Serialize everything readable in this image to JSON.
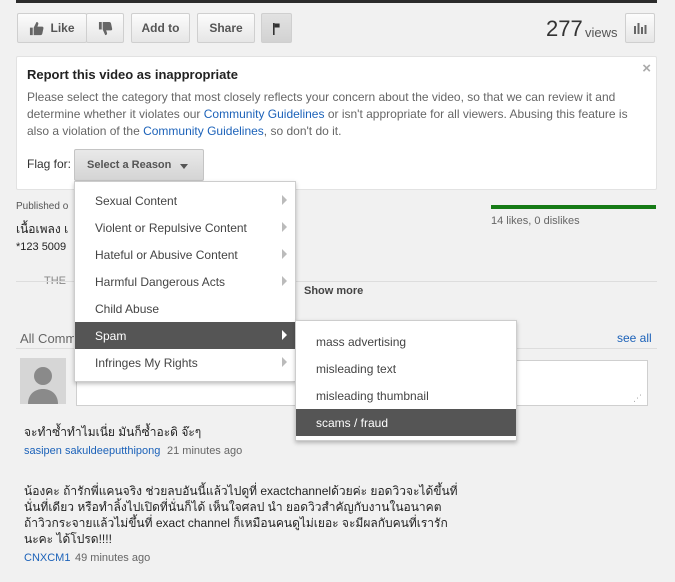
{
  "toolbar": {
    "like_label": "Like",
    "dislike_icon": "thumbs-down-icon",
    "addto_label": "Add to",
    "share_label": "Share",
    "flag_icon": "flag-icon",
    "views_count": "277",
    "views_label": "views",
    "stats_icon": "bar-chart-icon"
  },
  "report": {
    "title": "Report this video as inappropriate",
    "close_glyph": "×",
    "desc_part1": "Please select the category that most closely reflects your concern about the video, so that we can review it and determine whether it violates our ",
    "guidelines_link_1": "Community Guidelines",
    "desc_part2": " or isn't appropriate for all viewers. Abusing this feature is also a violation of the ",
    "guidelines_link_2": "Community Guidelines",
    "desc_part3": ", so don't do it.",
    "flag_for_label": "Flag for:",
    "select_label": "Select a Reason"
  },
  "reasons": [
    {
      "label": "Sexual Content",
      "has_submenu": true
    },
    {
      "label": "Violent or Repulsive Content",
      "has_submenu": true
    },
    {
      "label": "Hateful or Abusive Content",
      "has_submenu": true
    },
    {
      "label": "Harmful Dangerous Acts",
      "has_submenu": true
    },
    {
      "label": "Child Abuse",
      "has_submenu": false
    },
    {
      "label": "Spam",
      "has_submenu": true,
      "highlighted": true
    },
    {
      "label": "Infringes My Rights",
      "has_submenu": true
    }
  ],
  "spam_submenu": [
    {
      "label": "mass advertising"
    },
    {
      "label": "misleading text"
    },
    {
      "label": "misleading thumbnail"
    },
    {
      "label": "scams / fraud",
      "highlighted": true
    }
  ],
  "video_info": {
    "published": "Published o",
    "desc_line1": "เนื้อเพลง เ",
    "desc_line2": "*123 5009",
    "desc_line3": "THE",
    "likes_text": "14 likes, 0 dislikes",
    "show_more": "Show more"
  },
  "comments": {
    "header": "All Comm",
    "see_all": "see all",
    "list": [
      {
        "text": "จะทำซ้ำทำไมเนี่ย มันก็ซ้ำอะดิ จ๊ะๆ",
        "author": "sasipen sakuldeeputthipong",
        "time": "21 minutes ago"
      },
      {
        "text_lines": [
          "น้องคะ ถ้ารักพี่แคนจริง ช่วยลบอันนี้แล้วไปดูที่ exactchannelด้วยค่ะ ยอดวิวจะได้ขึ้นที่",
          "นั่นที่เดียว หรือทำลิ้งไปเปิดที่นั่นก็ได้ เห็นใจศลป นำ  ยอดวิวสำคัญกับงานในอนาคต",
          "ถ้าวิวกระจายแล้วไม่ขึ้นที่ exact channel ก็เหมือนคนดูไม่เยอะ จะมีผลกับคนที่เรารัก",
          "นะคะ ได้โปรด!!!!"
        ],
        "author": "CNXCM1",
        "time": "49 minutes ago"
      }
    ]
  },
  "colors": {
    "link": "#1c62b9",
    "like_bar": "#167b16",
    "menu_highlight": "#555555"
  }
}
